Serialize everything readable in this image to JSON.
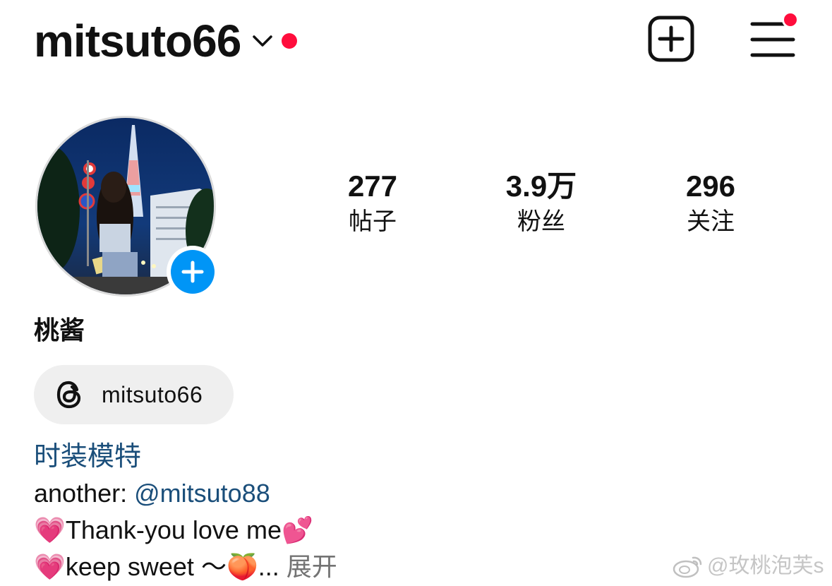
{
  "header": {
    "username": "mitsuto66",
    "has_notification": true
  },
  "profile": {
    "display_name": "桃酱",
    "threads_handle": "mitsuto66"
  },
  "stats": [
    {
      "value": "277",
      "label": "帖子"
    },
    {
      "value": "3.9万",
      "label": "粉丝"
    },
    {
      "value": "296",
      "label": "关注"
    }
  ],
  "bio": {
    "category": "时装模特",
    "line1_prefix": "another: ",
    "line1_mention": "@mitsuto88",
    "line2_emoji_start": "💗",
    "line2_text": "Thank-you love me",
    "line2_emoji_end": "💕",
    "line3_emoji_start": "💗",
    "line3_text": "keep sweet ～",
    "line3_emoji_end": "🍑",
    "line3_ellipsis": "... ",
    "more_label": "展开"
  },
  "watermark": {
    "text": "@玫桃泡芙s"
  },
  "icons": {
    "chevron": "chevron-down-icon",
    "new_post": "plus-square-icon",
    "menu": "hamburger-menu-icon",
    "add_story": "plus-circle-icon",
    "threads": "threads-logo-icon",
    "weibo": "weibo-logo-icon"
  },
  "colors": {
    "notification": "#ff0d3c",
    "add_story_blue": "#0095f6",
    "link_blue": "#1a4e7a",
    "pill_bg": "#efefef"
  }
}
